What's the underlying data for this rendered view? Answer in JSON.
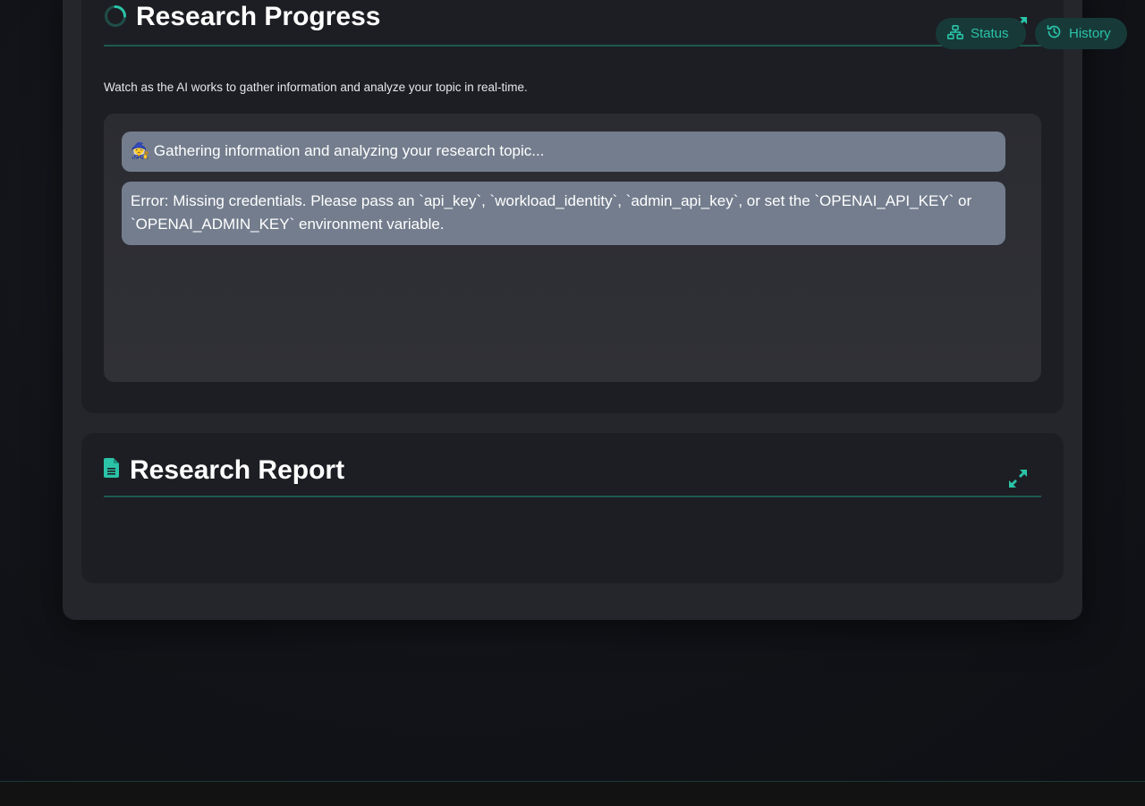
{
  "progress": {
    "title": "Research Progress",
    "subtitle": "Watch as the AI works to gather information and analyze your topic in real-time.",
    "messages": [
      "🧙 Gathering information and analyzing your research topic...",
      "Error: Missing credentials. Please pass an `api_key`, `workload_identity`, `admin_api_key`, or set the `OPENAI_API_KEY` or `OPENAI_ADMIN_KEY` environment variable."
    ]
  },
  "report": {
    "title": "Research Report"
  },
  "top_buttons": {
    "status_label": "Status",
    "history_label": "History"
  },
  "colors": {
    "accent": "#2ac3a8",
    "card_bg": "#1d1e23",
    "message_bg": "#737d8d",
    "pill_bg": "#173a39"
  },
  "icons": {
    "progress": "spinner-icon",
    "report": "document-icon",
    "expand": "expand-icon",
    "status": "sitemap-icon",
    "history": "history-icon"
  }
}
